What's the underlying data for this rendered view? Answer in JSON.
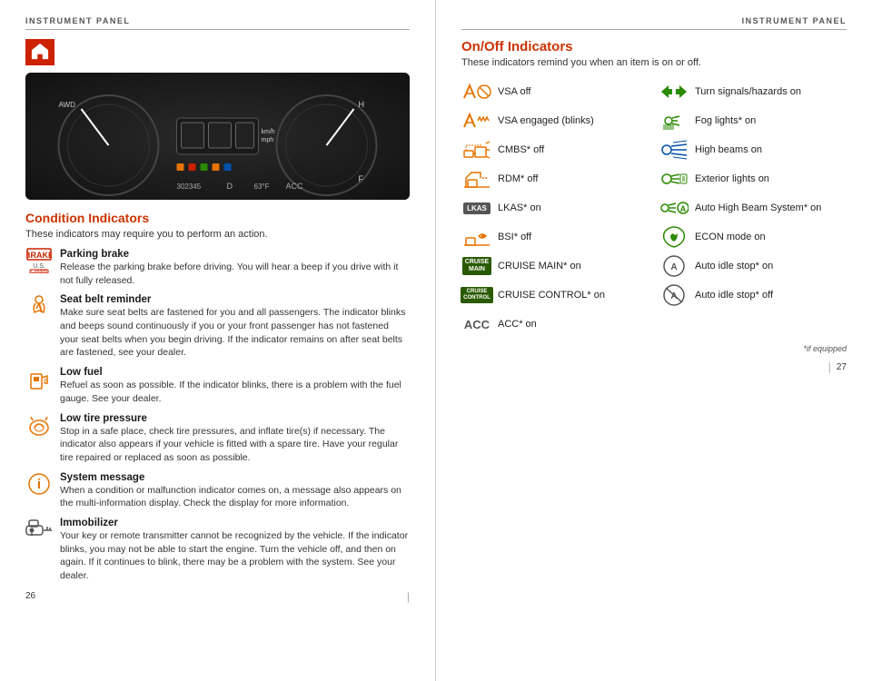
{
  "left": {
    "header": "INSTRUMENT PANEL",
    "section_title": "Condition Indicators",
    "section_subtitle": "These indicators may require you to perform an action.",
    "indicators": [
      {
        "id": "parking-brake",
        "icon_type": "brake",
        "title": "Parking brake",
        "desc": "Release the parking brake before driving. You will hear a beep if you drive with it not fully released."
      },
      {
        "id": "seat-belt",
        "icon_type": "seatbelt",
        "title": "Seat belt reminder",
        "desc": "Make sure seat belts are fastened for you and all passengers. The indicator blinks and beeps sound continuously if you or your front passenger has not fastened your seat belts when you begin driving. If the indicator remains on after seat belts are fastened, see your dealer."
      },
      {
        "id": "low-fuel",
        "icon_type": "fuel",
        "title": "Low fuel",
        "desc": "Refuel as soon as possible. If the indicator blinks, there is a problem with the fuel gauge. See your dealer."
      },
      {
        "id": "tire-pressure",
        "icon_type": "tire",
        "title": "Low tire pressure",
        "desc": "Stop in a safe place, check tire pressures, and inflate tire(s) if necessary. The indicator also appears if your vehicle is fitted with a spare tire. Have your regular tire repaired or replaced as soon as possible."
      },
      {
        "id": "system-message",
        "icon_type": "info",
        "title": "System message",
        "desc": "When a condition or malfunction indicator comes on, a message also appears on the multi-information display. Check the display for more information."
      },
      {
        "id": "immobilizer",
        "icon_type": "key",
        "title": "Immobilizer",
        "desc": "Your key or remote transmitter cannot be recognized by the vehicle. If the indicator blinks, you may not be able to start the engine. Turn the vehicle off, and then on again. If it continues to blink, there may be a problem with the system. See your dealer."
      }
    ],
    "page_num": "26"
  },
  "right": {
    "header": "INSTRUMENT PANEL",
    "section_title": "On/Off Indicators",
    "section_subtitle": "These indicators remind you when an item is on or off.",
    "indicators_col1": [
      {
        "id": "vsa-off",
        "icon_type": "vsa-off",
        "label": "VSA off"
      },
      {
        "id": "vsa-engaged",
        "icon_type": "vsa-blinks",
        "label": "VSA engaged (blinks)"
      },
      {
        "id": "cmbs-off",
        "icon_type": "cmbs",
        "label": "CMBS* off"
      },
      {
        "id": "rdm-off",
        "icon_type": "rdm",
        "label": "RDM* off"
      },
      {
        "id": "lkas-on",
        "icon_type": "lkas",
        "label": "LKAS* on"
      },
      {
        "id": "bsi-off",
        "icon_type": "bsi",
        "label": "BSI* off"
      },
      {
        "id": "cruise-main",
        "icon_type": "cruise-main",
        "label": "CRUISE MAIN* on"
      },
      {
        "id": "cruise-control",
        "icon_type": "cruise-control",
        "label": "CRUISE CONTROL* on"
      },
      {
        "id": "acc-on",
        "icon_type": "acc",
        "label": "ACC* on"
      }
    ],
    "indicators_col2": [
      {
        "id": "turn-signals",
        "icon_type": "turn-signals",
        "label": "Turn signals/hazards on"
      },
      {
        "id": "fog-lights",
        "icon_type": "fog-lights",
        "label": "Fog lights* on"
      },
      {
        "id": "high-beams",
        "icon_type": "high-beams",
        "label": "High beams on"
      },
      {
        "id": "exterior-lights",
        "icon_type": "exterior-lights",
        "label": "Exterior lights on"
      },
      {
        "id": "auto-high-beam",
        "icon_type": "auto-high-beam",
        "label": "Auto High Beam System* on"
      },
      {
        "id": "econ-mode",
        "icon_type": "econ",
        "label": "ECON mode on"
      },
      {
        "id": "auto-idle-stop",
        "icon_type": "auto-idle-stop-on",
        "label": "Auto idle stop* on"
      },
      {
        "id": "auto-idle-stop-off",
        "icon_type": "auto-idle-stop-off",
        "label": "Auto idle stop* off"
      }
    ],
    "if_equipped": "*if equipped",
    "page_num": "27"
  }
}
